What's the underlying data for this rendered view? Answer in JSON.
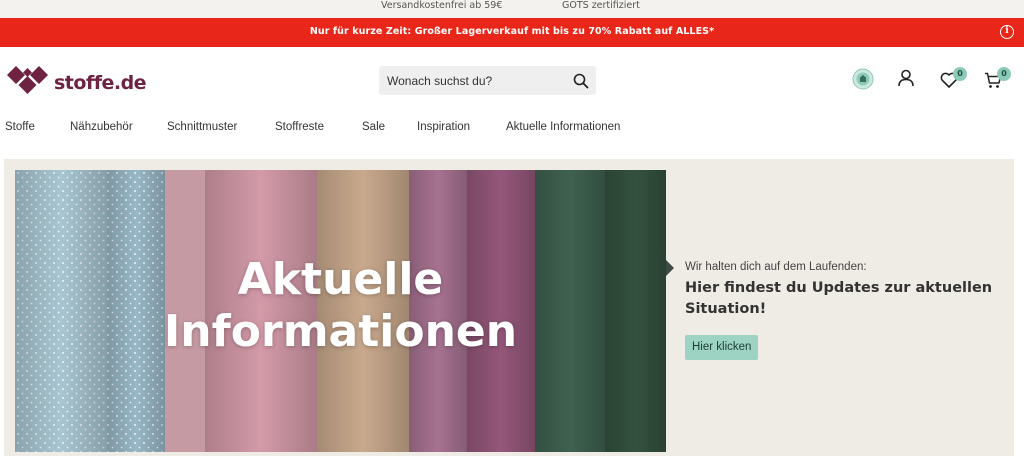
{
  "topbar": {
    "shipping": "Versandkostenfrei ab 59€",
    "certified": "GOTS zertifiziert"
  },
  "promo": {
    "text": "Nur für kurze Zeit: Großer Lagerverkauf mit bis zu 70% Rabatt auf ALLES*",
    "info_icon": "info-icon",
    "info_glyph": "i",
    "color": "#e8261a"
  },
  "header": {
    "brand": "stoffe.de",
    "brand_color": "#6e2342",
    "search": {
      "placeholder": "Wonach suchst du?"
    },
    "wishlist_count": "0",
    "cart_count": "0",
    "icons": [
      "diy-badge-icon",
      "user-icon",
      "heart-icon",
      "cart-icon"
    ]
  },
  "nav": {
    "items": [
      {
        "label": "Stoffe"
      },
      {
        "label": "Nähzubehör"
      },
      {
        "label": "Schnittmuster"
      },
      {
        "label": "Stoffreste"
      },
      {
        "label": "Sale"
      },
      {
        "label": "Inspiration"
      },
      {
        "label": "Aktuelle Informationen"
      }
    ]
  },
  "hero": {
    "title_line1": "Aktuelle",
    "title_line2": "Informationen",
    "kicker": "Wir halten dich auf dem Laufenden:",
    "headline": "Hier findest du Updates zur aktuellen Situation!",
    "cta": "Hier klicken",
    "accent": "#9dd3c2",
    "background": "#efebe5"
  }
}
